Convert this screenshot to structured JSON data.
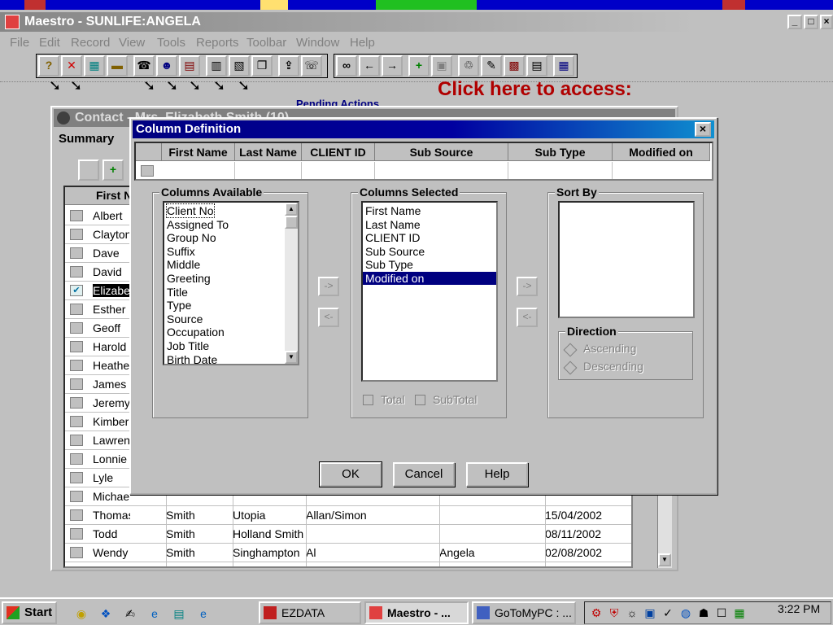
{
  "app": {
    "title": "Maestro - SUNLIFE:ANGELA",
    "contact_window_title": "Contact - Mrs. Elizabeth Smith (10)",
    "hint_text": "Click here to access:",
    "hint_link": "Pending Actions"
  },
  "menu": [
    "File",
    "Edit",
    "Record",
    "View",
    "Tools",
    "Reports",
    "Toolbar",
    "Window",
    "Help"
  ],
  "toolbar_icons": [
    "help-icon",
    "close-record-icon",
    "calculator-icon",
    "minus-icon",
    "phone-icon",
    "people-icon",
    "book-icon",
    "calendar-icon",
    "list-icon",
    "copy-icon",
    "export-icon",
    "dial-icon",
    "binoculars-icon",
    "back-arrow-icon",
    "forward-arrow-icon",
    "add-icon",
    "save-icon",
    "trash-icon",
    "edit-icon",
    "columns-icon",
    "report-icon",
    "grid-icon"
  ],
  "contact_window": {
    "tab": "Summary",
    "grid_header": "First N",
    "rows": [
      {
        "first": "Albert",
        "last": "",
        "city": "",
        "group": "",
        "agent": "",
        "date": ""
      },
      {
        "first": "Clayton",
        "last": "",
        "city": "",
        "group": "",
        "agent": "",
        "date": ""
      },
      {
        "first": "Dave",
        "last": "",
        "city": "",
        "group": "",
        "agent": "",
        "date": ""
      },
      {
        "first": "David",
        "last": "",
        "city": "",
        "group": "",
        "agent": "",
        "date": ""
      },
      {
        "first": "Elizabeth",
        "last": "",
        "city": "",
        "group": "",
        "agent": "",
        "date": ""
      },
      {
        "first": "Esther",
        "last": "",
        "city": "",
        "group": "",
        "agent": "",
        "date": ""
      },
      {
        "first": "Geoff",
        "last": "",
        "city": "",
        "group": "",
        "agent": "",
        "date": ""
      },
      {
        "first": "Harold",
        "last": "",
        "city": "",
        "group": "",
        "agent": "",
        "date": ""
      },
      {
        "first": "Heather",
        "last": "",
        "city": "",
        "group": "",
        "agent": "",
        "date": ""
      },
      {
        "first": "James",
        "last": "",
        "city": "",
        "group": "",
        "agent": "",
        "date": ""
      },
      {
        "first": "Jeremy",
        "last": "",
        "city": "",
        "group": "",
        "agent": "",
        "date": ""
      },
      {
        "first": "Kimberly",
        "last": "",
        "city": "",
        "group": "",
        "agent": "",
        "date": ""
      },
      {
        "first": "Lawrence",
        "last": "",
        "city": "",
        "group": "",
        "agent": "",
        "date": ""
      },
      {
        "first": "Lonnie",
        "last": "",
        "city": "",
        "group": "",
        "agent": "",
        "date": ""
      },
      {
        "first": "Lyle",
        "last": "",
        "city": "",
        "group": "",
        "agent": "",
        "date": ""
      },
      {
        "first": "Michael",
        "last": "",
        "city": "",
        "group": "",
        "agent": "",
        "date": ""
      },
      {
        "first": "Thomas",
        "last": "Smith",
        "city": "Utopia",
        "group": "Allan/Simon",
        "agent": "",
        "date": "15/04/2002"
      },
      {
        "first": "Todd",
        "last": "Smith",
        "city": "Holland Smith",
        "group": "",
        "agent": "",
        "date": "08/11/2002"
      },
      {
        "first": "Wendy",
        "last": "Smith",
        "city": "Singhampton",
        "group": "Al",
        "agent": "Angela",
        "date": "02/08/2002"
      }
    ]
  },
  "dialog": {
    "title": "Column Definition",
    "preview_columns": [
      "First Name",
      "Last Name",
      "CLIENT ID",
      "Sub Source",
      "Sub Type",
      "Modified on"
    ],
    "columns_available": {
      "label": "Columns Available",
      "items": [
        "Client No",
        "Assigned To",
        "Group No",
        "Suffix",
        "Middle",
        "Greeting",
        "Title",
        "Type",
        "Source",
        "Occupation",
        "Job Title",
        "Birth Date"
      ]
    },
    "columns_selected": {
      "label": "Columns Selected",
      "items": [
        "First Name",
        "Last Name",
        "CLIENT ID",
        "Sub Source",
        "Sub Type",
        "Modified on"
      ],
      "selected_index": 5
    },
    "sort_by": {
      "label": "Sort By",
      "items": []
    },
    "direction": {
      "label": "Direction",
      "options": [
        "Ascending",
        "Descending"
      ]
    },
    "total_label": "Total",
    "subtotal_label": "SubTotal",
    "move_right": "->",
    "move_left": "<-",
    "buttons": {
      "ok": "OK",
      "cancel": "Cancel",
      "help": "Help"
    }
  },
  "taskbar": {
    "start": "Start",
    "tasks": [
      "EZDATA",
      "Maestro - ...",
      "GoToMyPC : ..."
    ],
    "clock": "3:22 PM"
  }
}
